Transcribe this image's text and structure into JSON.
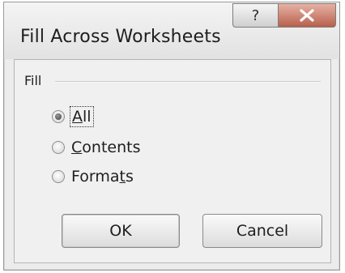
{
  "dialog": {
    "title": "Fill Across Worksheets",
    "help_glyph": "?",
    "close_icon": "close-icon"
  },
  "group": {
    "label": "Fill"
  },
  "options": [
    {
      "prefix": "",
      "accel": "A",
      "suffix": "ll",
      "checked": true
    },
    {
      "prefix": "",
      "accel": "C",
      "suffix": "ontents",
      "checked": false
    },
    {
      "prefix": "Forma",
      "accel": "t",
      "suffix": "s",
      "checked": false
    }
  ],
  "buttons": {
    "ok_label": "OK",
    "cancel_label": "Cancel"
  },
  "colors": {
    "close_button": "#b8604c",
    "dialog_background": "#f0f0f0"
  }
}
